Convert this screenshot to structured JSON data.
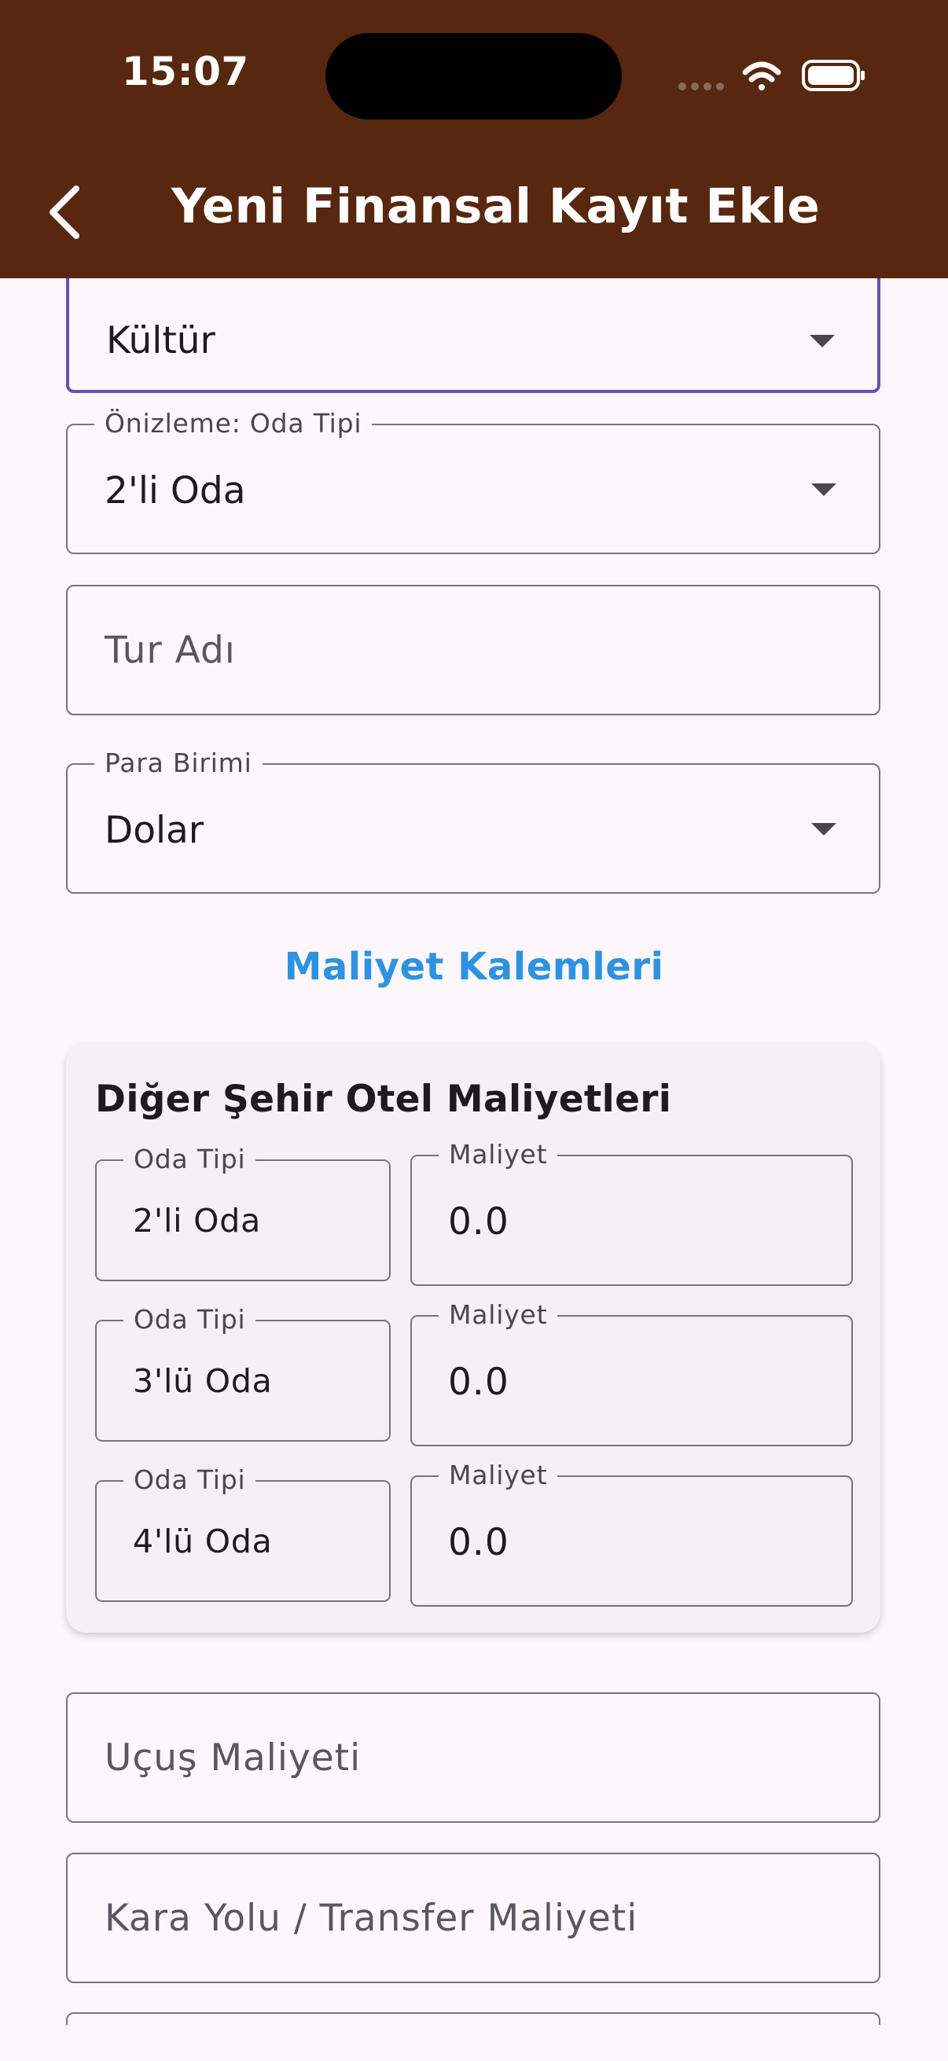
{
  "status_bar": {
    "time": "15:07"
  },
  "app_bar": {
    "title": "Yeni Finansal Kayıt Ekle",
    "back_icon": "chevron-left-icon",
    "background_color": "#57270f"
  },
  "form": {
    "category": {
      "value": "Kültür"
    },
    "room_type_preview": {
      "label": "Önizleme: Oda Tipi",
      "value": "2'li Oda"
    },
    "tour_name": {
      "placeholder": "Tur Adı"
    },
    "currency": {
      "label": "Para Birimi",
      "value": "Dolar"
    },
    "cost_items_title": "Maliyet Kalemleri",
    "hotel_costs_card": {
      "title": "Diğer Şehir Otel Maliyetleri",
      "rows": [
        {
          "room_label": "Oda Tipi",
          "room_value": "2'li Oda",
          "cost_label": "Maliyet",
          "cost_value": "0.0"
        },
        {
          "room_label": "Oda Tipi",
          "room_value": "3'lü Oda",
          "cost_label": "Maliyet",
          "cost_value": "0.0"
        },
        {
          "room_label": "Oda Tipi",
          "room_value": "4'lü Oda",
          "cost_label": "Maliyet",
          "cost_value": "0.0"
        }
      ]
    },
    "flight_cost": {
      "placeholder": "Uçuş Maliyeti"
    },
    "ground_transfer_cost": {
      "placeholder": "Kara Yolu / Transfer Maliyeti"
    }
  },
  "colors": {
    "accent_blue": "#2d93e0",
    "focus_purple": "#6a4fb3"
  }
}
